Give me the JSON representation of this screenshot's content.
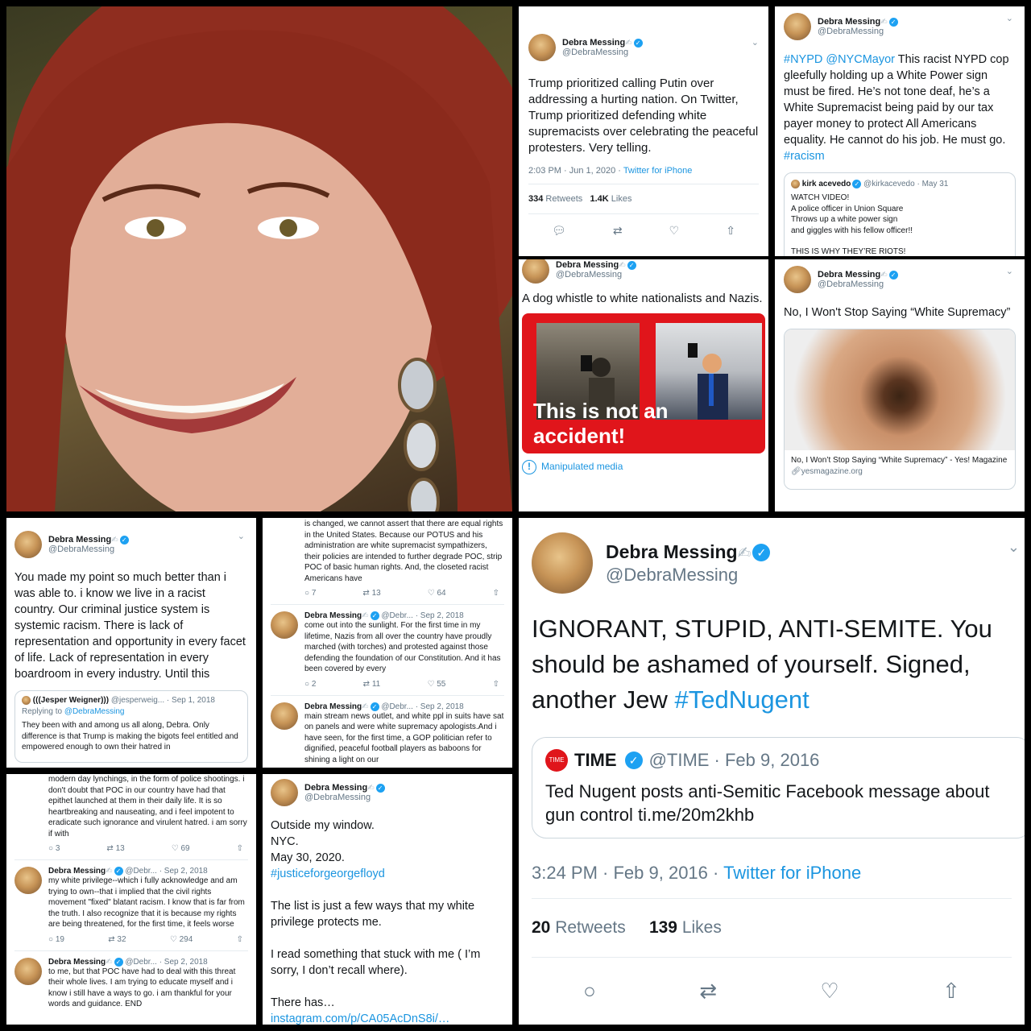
{
  "author": {
    "name": "Debra Messing",
    "handle": "@DebraMessing",
    "handle_short": "@Debr..."
  },
  "colors": {
    "twitter_blue": "#1da1f2",
    "link_blue": "#1b95e0",
    "alert_red": "#e0151b",
    "gray": "#657786"
  },
  "icons": [
    "reply-icon",
    "retweet-icon",
    "like-icon",
    "share-icon",
    "verified-icon",
    "chevron-down-icon",
    "info-icon",
    "link-icon"
  ],
  "t1": {
    "text": "Trump prioritized calling Putin over addressing a hurting nation. On Twitter, Trump prioritized defending white supremacists over celebrating the peaceful protesters.  Very telling.",
    "time": "2:03 PM · Jun 1, 2020 · ",
    "source": "Twitter for iPhone",
    "retweets": "334",
    "retweets_label": "Retweets",
    "likes": "1.4K",
    "likes_label": "Likes"
  },
  "t2": {
    "tags": "#NYPD @NYCMayor",
    "text": " This racist NYPD cop gleefully holding up a White Power sign must be fired. He’s not tone deaf, he’s a White Supremacist being paid by our tax payer money to protect All Americans equality. He cannot do his job. He must go. ",
    "tag_end": "#racism",
    "quote": {
      "name": "kirk acevedo",
      "handle": "@kirkacevedo · May 31",
      "lines": [
        "WATCH VIDEO!",
        "A police officer in Union Square",
        "Throws up a white power sign",
        "and giggles with his fellow officer!!",
        "",
        "THIS IS WHY THEY’RE RIOTS!"
      ]
    }
  },
  "t3": {
    "text": "A dog whistle to white nationalists and Nazis.",
    "banner": "This is not an accident!",
    "manipulated": "Manipulated media"
  },
  "t4": {
    "text": "No, I Won't Stop Saying “White Supremacy”",
    "card_title": "No, I Won’t Stop Saying “White Supremacy” - Yes! Magazine",
    "card_domain": "yesmagazine.org"
  },
  "t5": {
    "text": "You made my point so much better than i was able to. i know we live in a racist country. Our criminal justice system is systemic racism. There is lack of representation and opportunity in every facet of life. Lack of representation in every boardroom in every industry. Until this",
    "quote_name": "(((Jesper Weigner)))",
    "quote_handle": "@jesperweig... · Sep 1, 2018",
    "replying": "Replying to ",
    "replying_to": "@DebraMessing",
    "quote_text": "They been with and among us all along, Debra. Only difference is that Trump is making the bigots feel entitled and empowered enough to own their hatred in"
  },
  "t6": {
    "top_text": "is changed, we cannot assert that there are equal rights in the United States. Because our POTUS and his administration are white supremacist sympathizers, their policies are intended to further degrade POC, strip POC of basic human rights. And, the closeted racist Americans have",
    "top_counts": [
      "7",
      "13",
      "64"
    ],
    "date": "· Sep 2, 2018",
    "mid_text": "come out into the sunlight. For the first time in my lifetime, Nazis from all over the country have proudly marched (with torches) and protested against those defending the foundation of our Constitution. And it has been covered by every",
    "mid_counts": [
      "2",
      "11",
      "55"
    ],
    "bot_text": "main stream news outlet, and white ppl in suits have sat on panels and were white supremacy apologists.And i have seen, for the first time, a GOP politician refer to dignified, peaceful football players as baboons for shining a light on our"
  },
  "t7": {
    "top_text": "modern day lynchings, in the form of police shootings. i don't doubt that POC in our country have had that epithet launched at them in their daily life. It is so heartbreaking and nauseating, and i feel impotent to eradicate such ignorance and virulent hatred. i am sorry if with",
    "top_counts": [
      "3",
      "13",
      "69"
    ],
    "date": "· Sep 2, 2018",
    "mid_text": "my white privilege--which i fully acknowledge and am trying to own--that i implied that the civil rights movement \"fixed\" blatant racism. I know that is far from the truth. I also recognize that it is because my rights are being threatened, for the first time, it feels worse",
    "mid_counts": [
      "19",
      "32",
      "294"
    ],
    "bot_text": "to me, but that POC have had to deal with this threat their whole lives. I am trying to educate myself and i know i still have a ways to go. i am thankful for your words and guidance. END"
  },
  "t8": {
    "l1": "Outside my window.",
    "l2": "NYC.",
    "l3": "May 30, 2020.",
    "tag": "#justiceforgeorgefloyd",
    "p2": "The list is just a few ways that  my white privilege protects me.",
    "p3": "I read something that stuck with me ( I’m sorry, I don’t recall where).",
    "p4": "There has…",
    "link": "instagram.com/p/CA05AcDnS8i/…"
  },
  "t9": {
    "text": "IGNORANT, STUPID, ANTI-SEMITE. You should be ashamed of yourself. Signed, another Jew ",
    "tag": "#TedNugent",
    "quote_logo": "TIME",
    "quote_name": "TIME",
    "quote_handle": "@TIME · Feb 9, 2016",
    "quote_text": "Ted Nugent posts anti-Semitic Facebook message about gun control ti.me/20m2khb",
    "time": "3:24 PM · Feb 9, 2016 · ",
    "source": "Twitter for iPhone",
    "retweets": "20",
    "retweets_label": "Retweets",
    "likes": "139",
    "likes_label": "Likes"
  }
}
